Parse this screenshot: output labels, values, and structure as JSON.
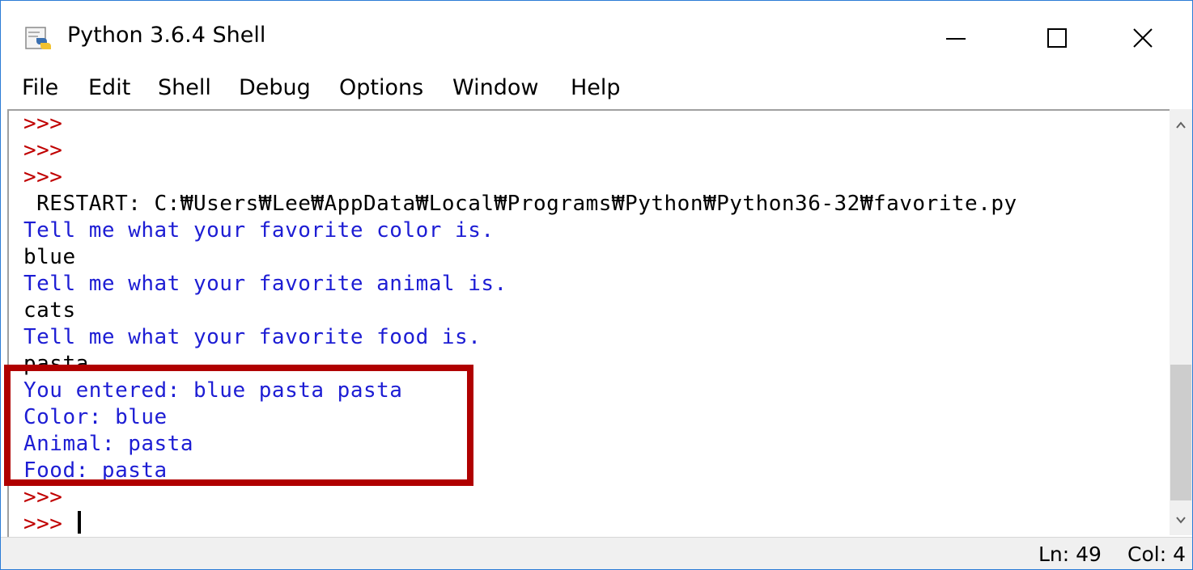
{
  "window": {
    "title": "Python 3.6.4 Shell",
    "icon": "python-idle-icon",
    "controls": {
      "minimize": "minimize-icon",
      "maximize": "maximize-icon",
      "close": "close-icon"
    }
  },
  "menu": [
    "File",
    "Edit",
    "Shell",
    "Debug",
    "Options",
    "Window",
    "Help"
  ],
  "shell": {
    "lines": [
      {
        "kind": "prompt",
        "text": ">>>"
      },
      {
        "kind": "prompt",
        "text": ">>>"
      },
      {
        "kind": "prompt",
        "text": ">>>"
      },
      {
        "kind": "restart",
        "text": " RESTART: C:₩Users₩Lee₩AppData₩Local₩Programs₩Python₩Python36-32₩favorite.py"
      },
      {
        "kind": "output",
        "text": "Tell me what your favorite color is."
      },
      {
        "kind": "stdin",
        "text": "blue"
      },
      {
        "kind": "output",
        "text": "Tell me what your favorite animal is."
      },
      {
        "kind": "stdin",
        "text": "cats"
      },
      {
        "kind": "output",
        "text": "Tell me what your favorite food is."
      },
      {
        "kind": "stdin",
        "text": "pasta"
      },
      {
        "kind": "output",
        "text": "You entered: blue pasta pasta"
      },
      {
        "kind": "output",
        "text": "Color: blue"
      },
      {
        "kind": "output",
        "text": "Animal: pasta"
      },
      {
        "kind": "output",
        "text": "Food: pasta"
      },
      {
        "kind": "prompt",
        "text": ">>>"
      },
      {
        "kind": "prompt",
        "text": ">>> "
      }
    ],
    "highlight_color": "#b00000",
    "prompt_color": "#c00000",
    "output_color": "#1d1dd4"
  },
  "status": {
    "line": "Ln: 49",
    "col": "Col: 4"
  }
}
